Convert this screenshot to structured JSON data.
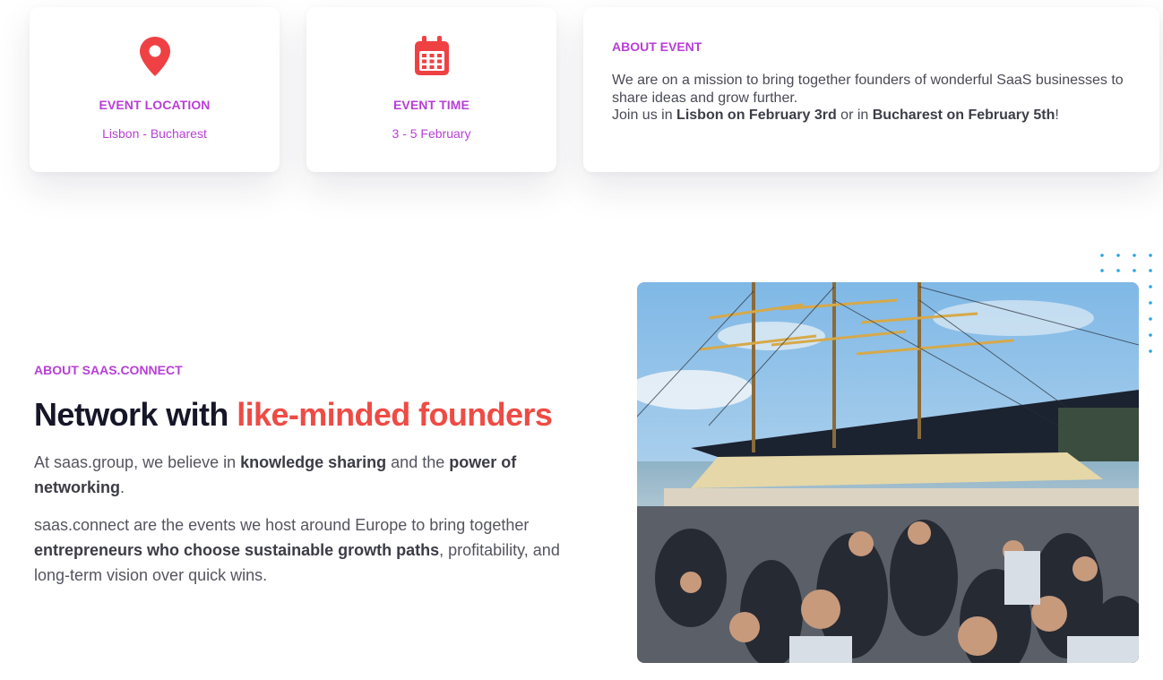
{
  "cards": {
    "location": {
      "icon": "map-pin-icon",
      "title": "EVENT LOCATION",
      "value": "Lisbon - Bucharest"
    },
    "time": {
      "icon": "calendar-icon",
      "title": "EVENT TIME",
      "value": "3 - 5 February"
    }
  },
  "about_event": {
    "eyebrow": "ABOUT EVENT",
    "line1": "We are on a mission to bring together founders of wonderful SaaS businesses to share ideas and grow further.",
    "line2_pre": "Join us in ",
    "line2_b1": "Lisbon on February 3rd",
    "line2_mid": " or in ",
    "line2_b2": "Bucharest on February 5th",
    "line2_end": "!"
  },
  "about_saas": {
    "eyebrow": "ABOUT SAAS.CONNECT",
    "title_plain": "Network with ",
    "title_highlight": "like-minded founders",
    "p1_a": "At saas.group, we believe in ",
    "p1_b1": "knowledge sharing",
    "p1_c": " and the ",
    "p1_b2": "power of networking",
    "p1_d": ".",
    "p2_a": "saas.connect are the events we host around Europe to bring together ",
    "p2_b": "entrepreneurs who choose sustainable growth paths",
    "p2_c": ", profitability, and long-term vision over quick wins."
  },
  "colors": {
    "accent_purple": "#b73fd6",
    "accent_red": "#ee4b45",
    "icon_red": "#ef4143",
    "dots_blue": "#2aa6e0"
  }
}
